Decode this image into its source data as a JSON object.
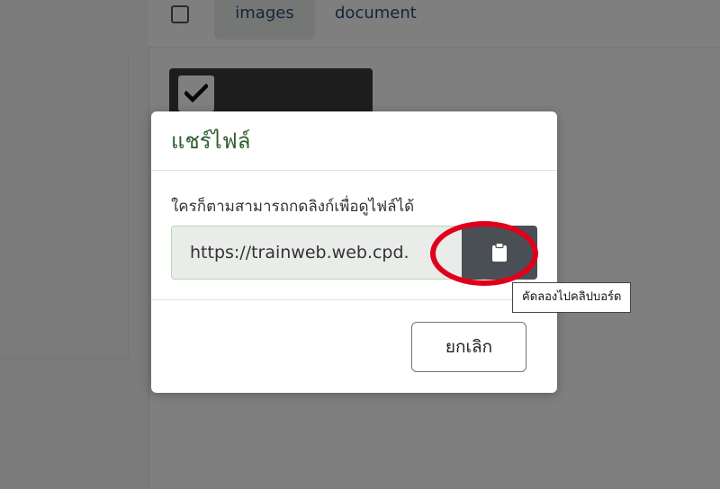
{
  "background": {
    "tabs": [
      {
        "label": "images"
      },
      {
        "label": "document"
      }
    ]
  },
  "modal": {
    "title": "แชร์ไฟล์",
    "description": "ใครก็ตามสามารถกดลิงก์เพื่อดูไฟล์ได้",
    "link_value": "https://trainweb.web.cpd.",
    "copy_icon": "clipboard-icon",
    "cancel_label": "ยกเลิก"
  },
  "tooltip": {
    "text": "คัดลองไปคลิปบอร์ด"
  },
  "colors": {
    "title_green": "#2e5e2e",
    "copy_button_bg": "#4a4f55",
    "annotation_red": "#e0001b"
  }
}
